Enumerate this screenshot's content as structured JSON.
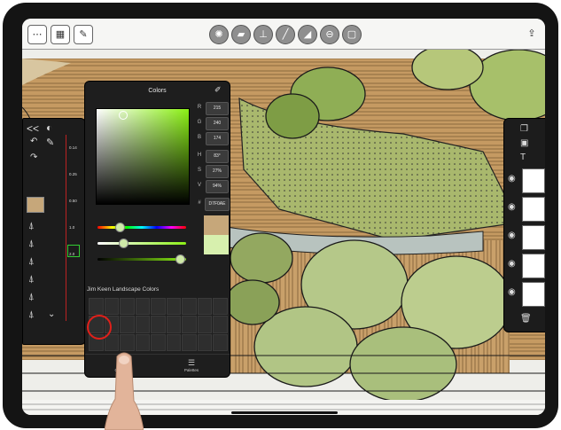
{
  "colors_panel": {
    "title": "Colors",
    "values": [
      {
        "label": "R",
        "value": "215"
      },
      {
        "label": "G",
        "value": "240"
      },
      {
        "label": "B",
        "value": "174"
      },
      {
        "label": "H",
        "value": "83°"
      },
      {
        "label": "S",
        "value": "27%"
      },
      {
        "label": "V",
        "value": "94%"
      },
      {
        "label": "#",
        "value": "D7F0AE"
      }
    ],
    "swatch_previous": "#c6a77a",
    "swatch_current": "#d7f0ae",
    "palette_name": "Jim Keen Landscape Colors",
    "tab_colors": "Colors",
    "tab_palettes": "Palettes",
    "accent": "#e0201a"
  },
  "left_tray": {
    "collapse": "<<",
    "brush_sizes": [
      "0.14",
      "0.25",
      "0.50",
      "1.0",
      "2.0"
    ]
  },
  "icons": [
    "menu-icon",
    "grid-icon",
    "wrench-icon",
    "brush-tool-icon",
    "ruler-icon",
    "compass-icon",
    "pen-icon",
    "triangle-icon",
    "circle-minus-icon",
    "square-tool-icon",
    "share-icon",
    "layers-icon",
    "eye-icon",
    "trash-icon",
    "pencil-icon"
  ]
}
